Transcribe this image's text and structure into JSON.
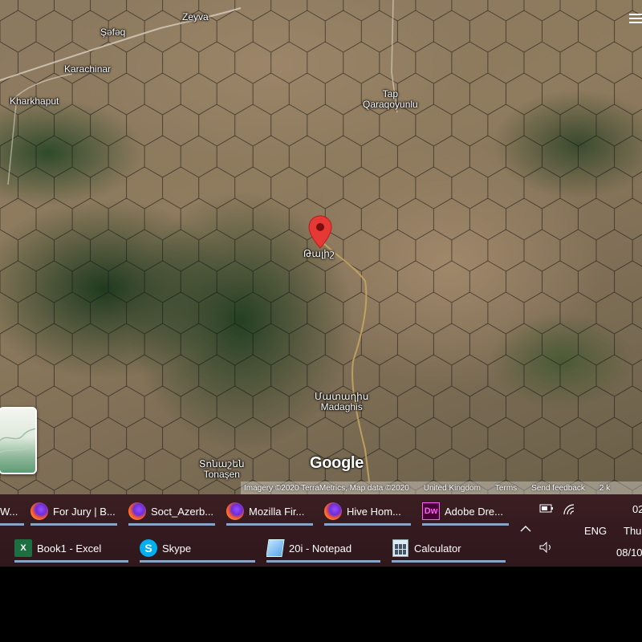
{
  "map": {
    "places": [
      {
        "id": "zeyva",
        "lines": [
          "Zeyva"
        ]
      },
      {
        "id": "sefeq",
        "lines": [
          "Şəfəq"
        ]
      },
      {
        "id": "karachinar",
        "lines": [
          "Karachinar"
        ]
      },
      {
        "id": "kharkhaput",
        "lines": [
          "Kharkhaput"
        ]
      },
      {
        "id": "tap",
        "lines": [
          "Tap",
          "Qaraqoyunlu"
        ]
      },
      {
        "id": "pin_label",
        "lines": [
          "Թալիշ"
        ]
      },
      {
        "id": "madaghis",
        "lines": [
          "Մատաղիս",
          "Madaghis"
        ]
      },
      {
        "id": "tonasen",
        "lines": [
          "Տոնաշեն",
          "Tonaşen"
        ]
      }
    ],
    "google_logo": "Google",
    "attribution": {
      "imagery": "Imagery ©2020 TerraMetrics, Map data ©2020",
      "region": "United Kingdom",
      "terms": "Terms",
      "feedback": "Send feedback",
      "scale": "2 k"
    },
    "pin_color": "#e53935"
  },
  "taskbar": {
    "row1": [
      {
        "label": "W...",
        "icon": "window-icon"
      },
      {
        "label": "For Jury | B...",
        "icon": "firefox-icon"
      },
      {
        "label": "Soct_Azerb...",
        "icon": "firefox-icon"
      },
      {
        "label": "Mozilla Fir...",
        "icon": "firefox-icon"
      },
      {
        "label": "Hive Hom...",
        "icon": "firefox-icon"
      },
      {
        "label": "Adobe Dre...",
        "icon": "dreamweaver-icon",
        "icon_text": "Dw"
      }
    ],
    "row2": [
      {
        "label": "Book1 - Excel",
        "icon": "excel-icon",
        "icon_text": "X"
      },
      {
        "label": "Skype",
        "icon": "skype-icon",
        "icon_text": "S"
      },
      {
        "label": "20i - Notepad",
        "icon": "notepad-icon"
      },
      {
        "label": "Calculator",
        "icon": "calculator-icon"
      }
    ],
    "tray": {
      "language": "ENG",
      "time": "02",
      "day": "Thur",
      "date": "08/10"
    },
    "colors": {
      "background": "#341a1e",
      "active_underline": "#8aa4c8"
    }
  }
}
